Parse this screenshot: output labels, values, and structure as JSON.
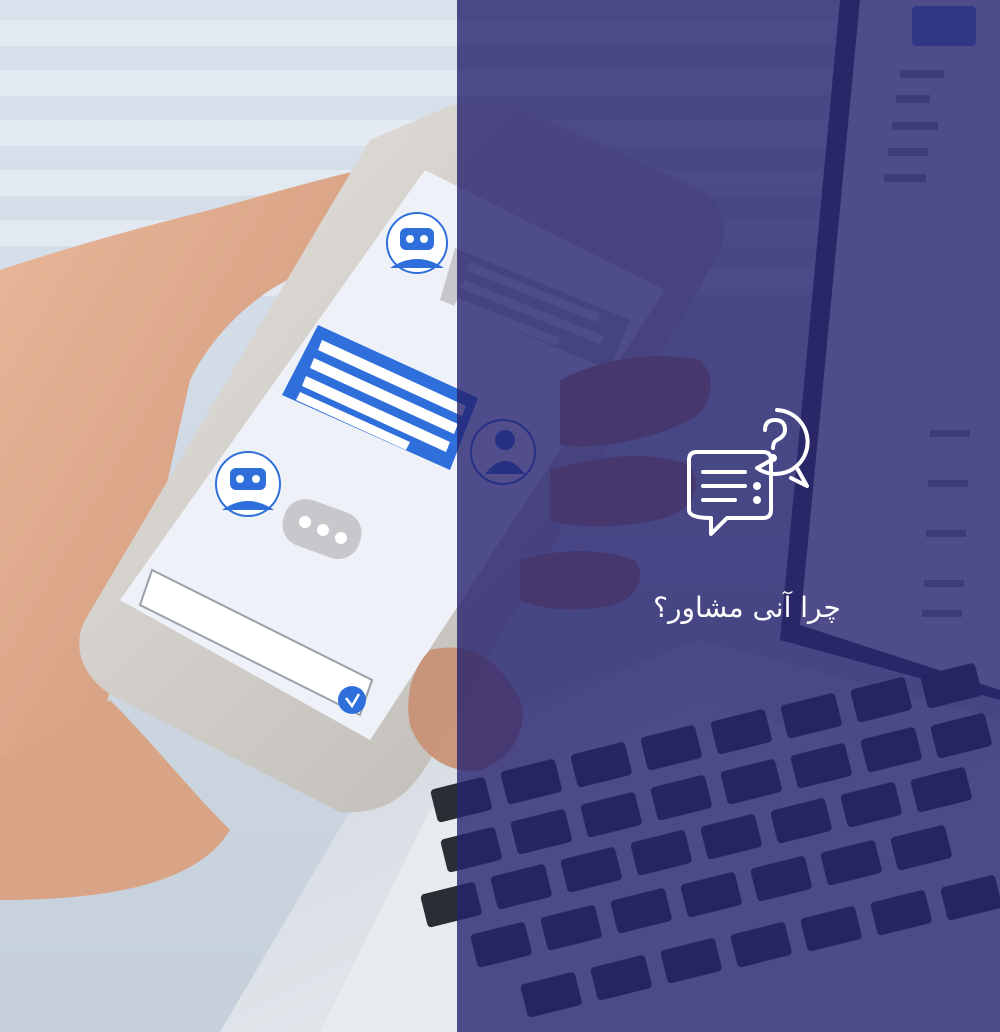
{
  "colors": {
    "overlay": "#26226e",
    "chat_blue": "#2f6fdc",
    "bubble_gray": "#c8c8cc",
    "phone_white": "#eef2f8"
  },
  "icons": {
    "promo": "chat-question-icon",
    "bot": "robot-avatar-icon",
    "user": "user-avatar-icon",
    "send": "send-chevron-icon"
  },
  "promo": {
    "title": "چرا آنی مشاور؟"
  }
}
